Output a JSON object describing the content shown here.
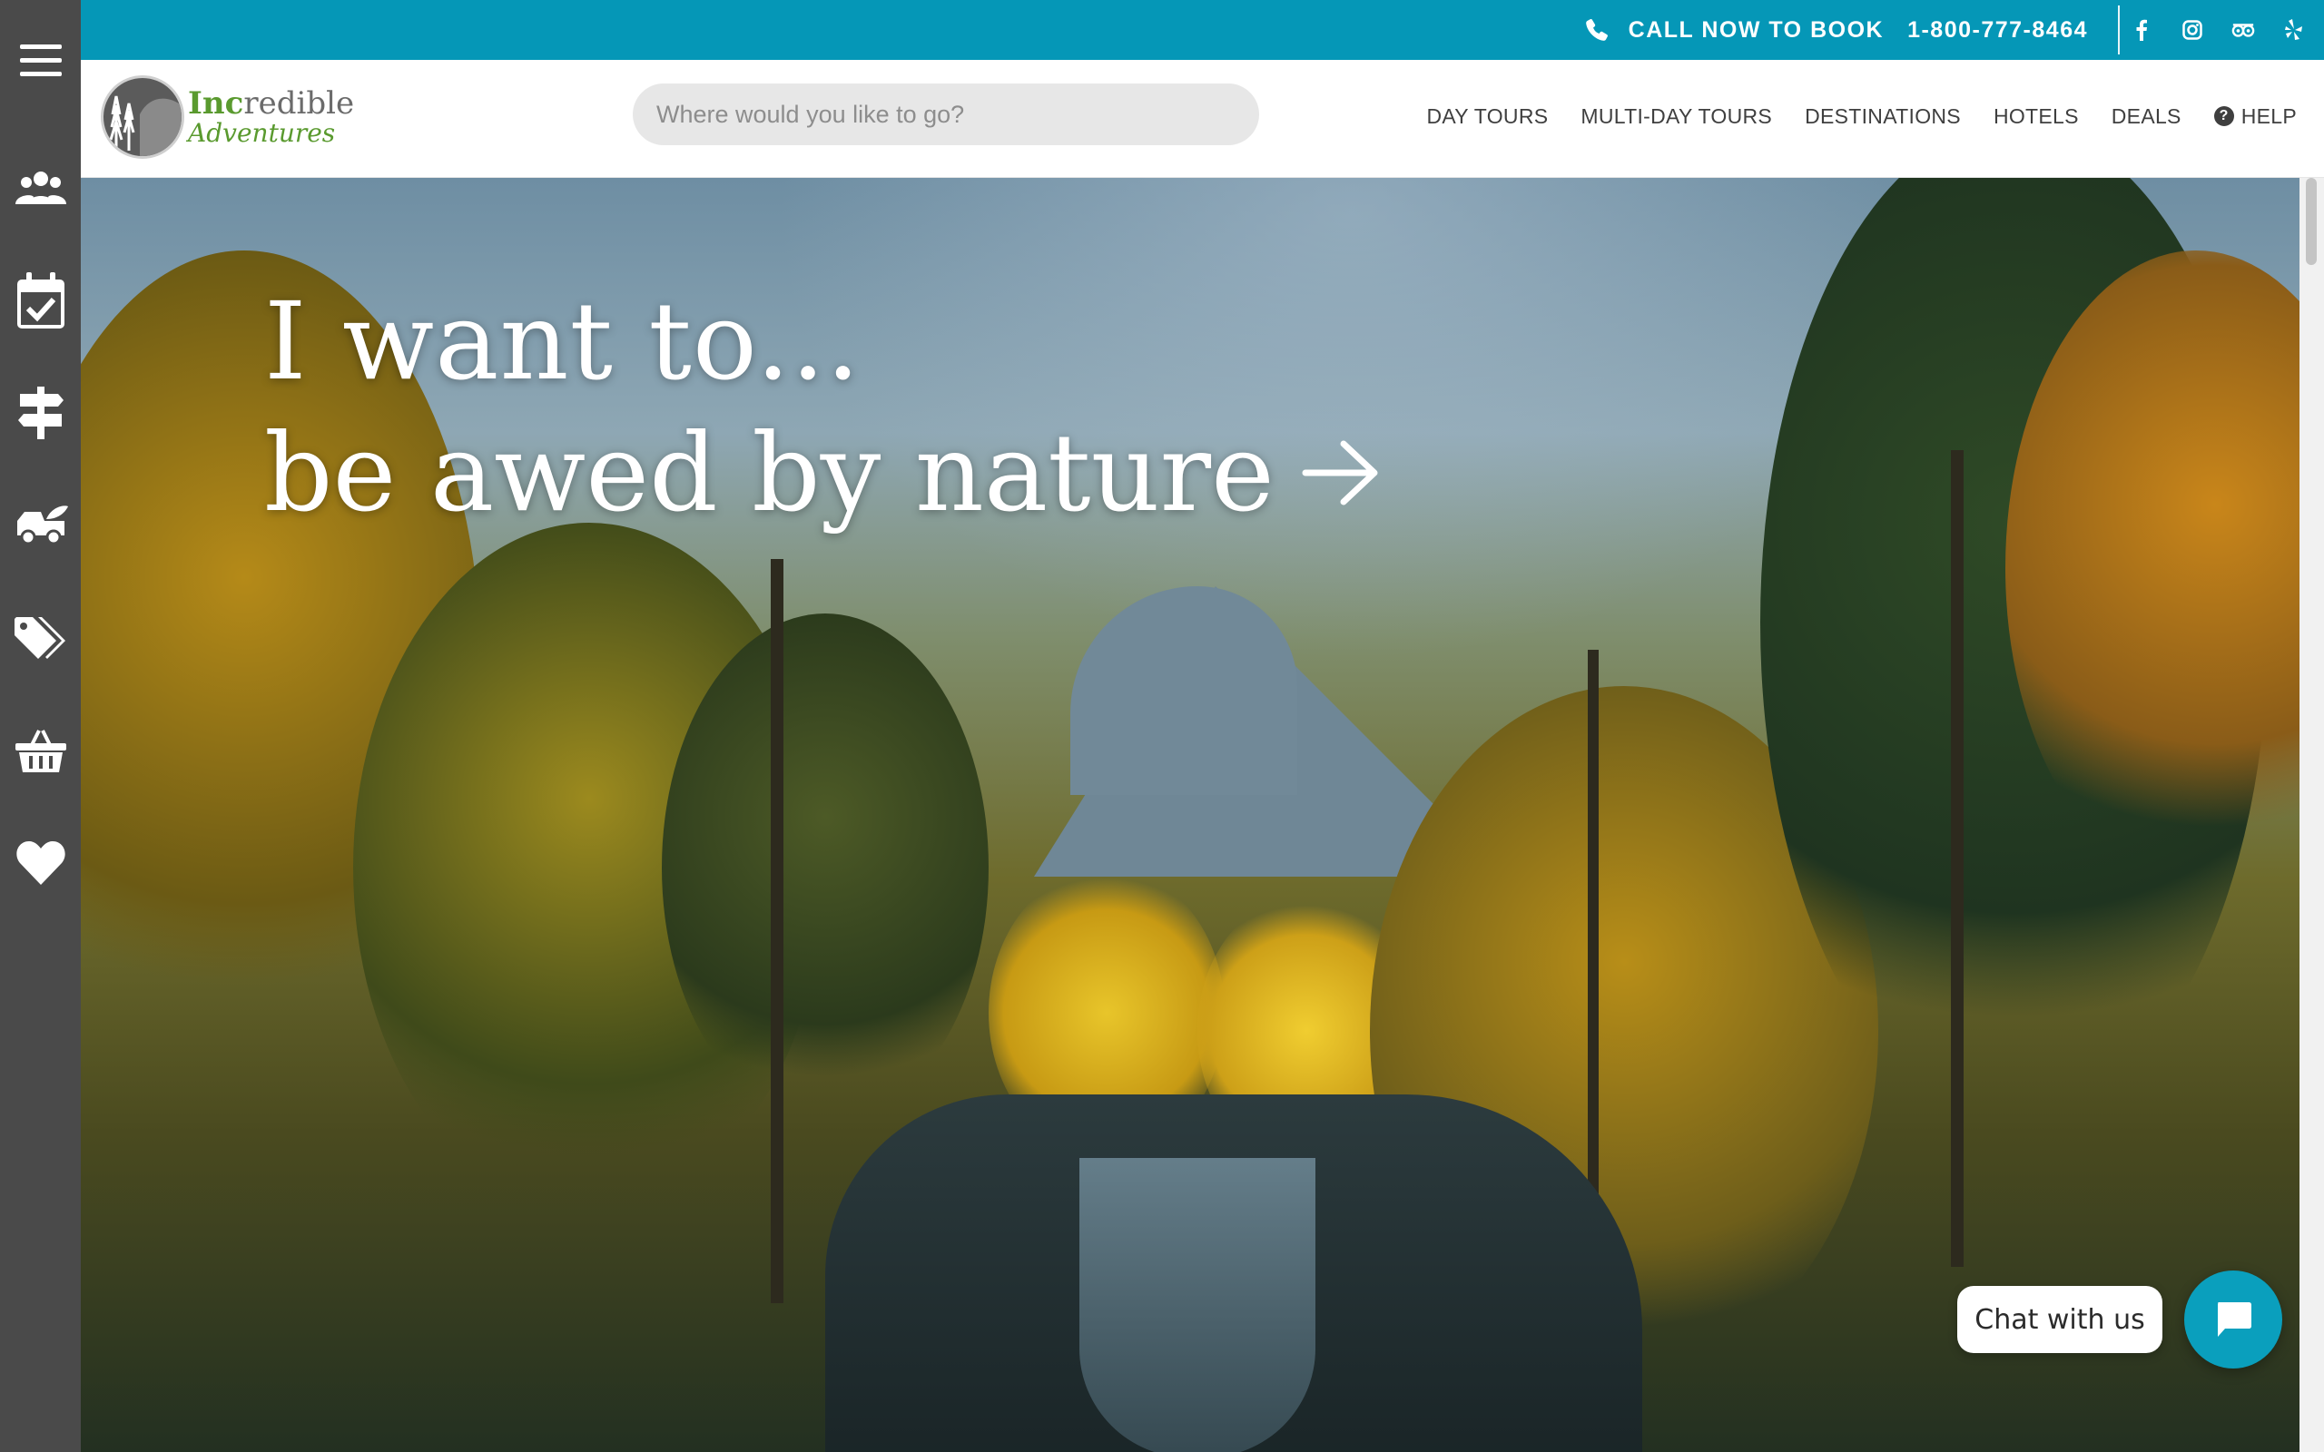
{
  "colors": {
    "accent": "#0597b7",
    "sidebar": "#4a4a4a",
    "brand_green": "#5a9a2f",
    "chat_button": "#0a9fbd"
  },
  "sidebar": {
    "items": [
      {
        "icon": "menu-icon"
      },
      {
        "icon": "group-icon"
      },
      {
        "icon": "calendar-check-icon"
      },
      {
        "icon": "signpost-icon"
      },
      {
        "icon": "vehicle-icon"
      },
      {
        "icon": "tags-icon"
      },
      {
        "icon": "basket-icon"
      },
      {
        "icon": "heart-icon"
      }
    ]
  },
  "topbar": {
    "call_label": "CALL NOW TO BOOK",
    "phone_number": "1-800-777-8464",
    "phone_icon": "phone-icon",
    "socials": [
      "facebook-icon",
      "instagram-icon",
      "tripadvisor-icon",
      "yelp-icon"
    ]
  },
  "header": {
    "logo": {
      "line1_bold": "Inc",
      "line1_rest": "redible",
      "line2": "Adventures"
    },
    "search": {
      "placeholder": "Where would you like to go?",
      "value": ""
    },
    "nav": [
      {
        "label": "DAY TOURS"
      },
      {
        "label": "MULTI-DAY TOURS"
      },
      {
        "label": "DESTINATIONS"
      },
      {
        "label": "HOTELS"
      },
      {
        "label": "DEALS"
      },
      {
        "label": "HELP",
        "icon": "question-circle-icon"
      }
    ]
  },
  "hero": {
    "line1": "I want to...",
    "line2": "be awed by nature",
    "arrow_icon": "arrow-right-icon"
  },
  "chat": {
    "label": "Chat with us",
    "icon": "chat-bubble-icon"
  }
}
